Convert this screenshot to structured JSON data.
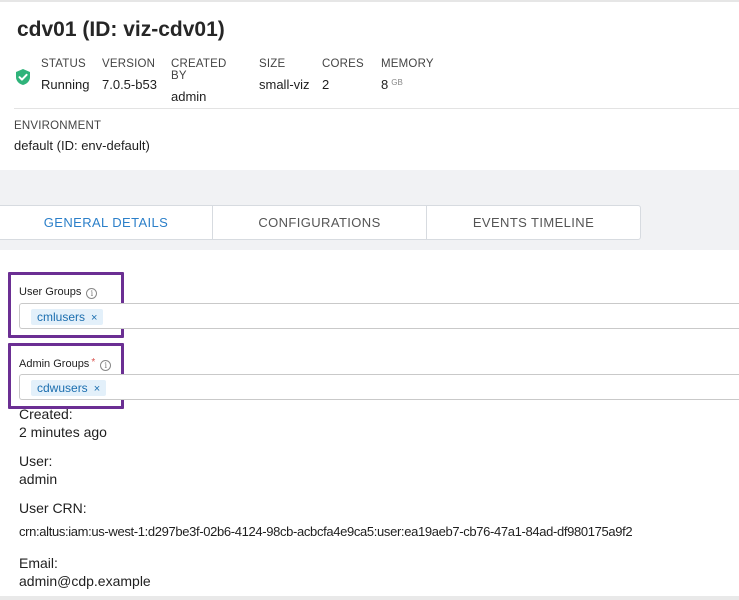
{
  "header": {
    "title": "cdv01 (ID: viz-cdv01)"
  },
  "summary": {
    "status_icon": "check-shield-icon",
    "status_color": "#2fb37a",
    "fields": [
      {
        "label": "STATUS",
        "value": "Running"
      },
      {
        "label": "VERSION",
        "value": "7.0.5-b53"
      },
      {
        "label": "CREATED BY",
        "value": "admin"
      },
      {
        "label": "SIZE",
        "value": "small-viz"
      },
      {
        "label": "CORES",
        "value": "2"
      },
      {
        "label": "MEMORY",
        "value": "8",
        "unit": "GB"
      }
    ]
  },
  "environment": {
    "label": "ENVIRONMENT",
    "value": "default (ID: env-default)"
  },
  "tabs": [
    {
      "label": "GENERAL DETAILS",
      "active": true
    },
    {
      "label": "CONFIGURATIONS",
      "active": false
    },
    {
      "label": "EVENTS TIMELINE",
      "active": false
    }
  ],
  "user_groups": {
    "label": "User Groups",
    "tags": [
      "cmlusers"
    ],
    "remove_glyph": "×"
  },
  "admin_groups": {
    "label": "Admin Groups",
    "required_mark": "*",
    "tags": [
      "cdwusers"
    ],
    "remove_glyph": "×"
  },
  "details": {
    "created_label": "Created:",
    "created_value": "2 minutes ago",
    "user_label": "User:",
    "user_value": "admin",
    "crn_label": "User CRN:",
    "crn_value": "crn:altus:iam:us-west-1:d297be3f-02b6-4124-98cb-acbcfa4e9ca5:user:ea19aeb7-cb76-47a1-84ad-df980175a9f2",
    "email_label": "Email:",
    "email_value": "admin@cdp.example"
  },
  "colors": {
    "accent": "#2b7fc9",
    "highlight_box": "#6b2f93",
    "tag_bg": "#e3f0fa"
  }
}
